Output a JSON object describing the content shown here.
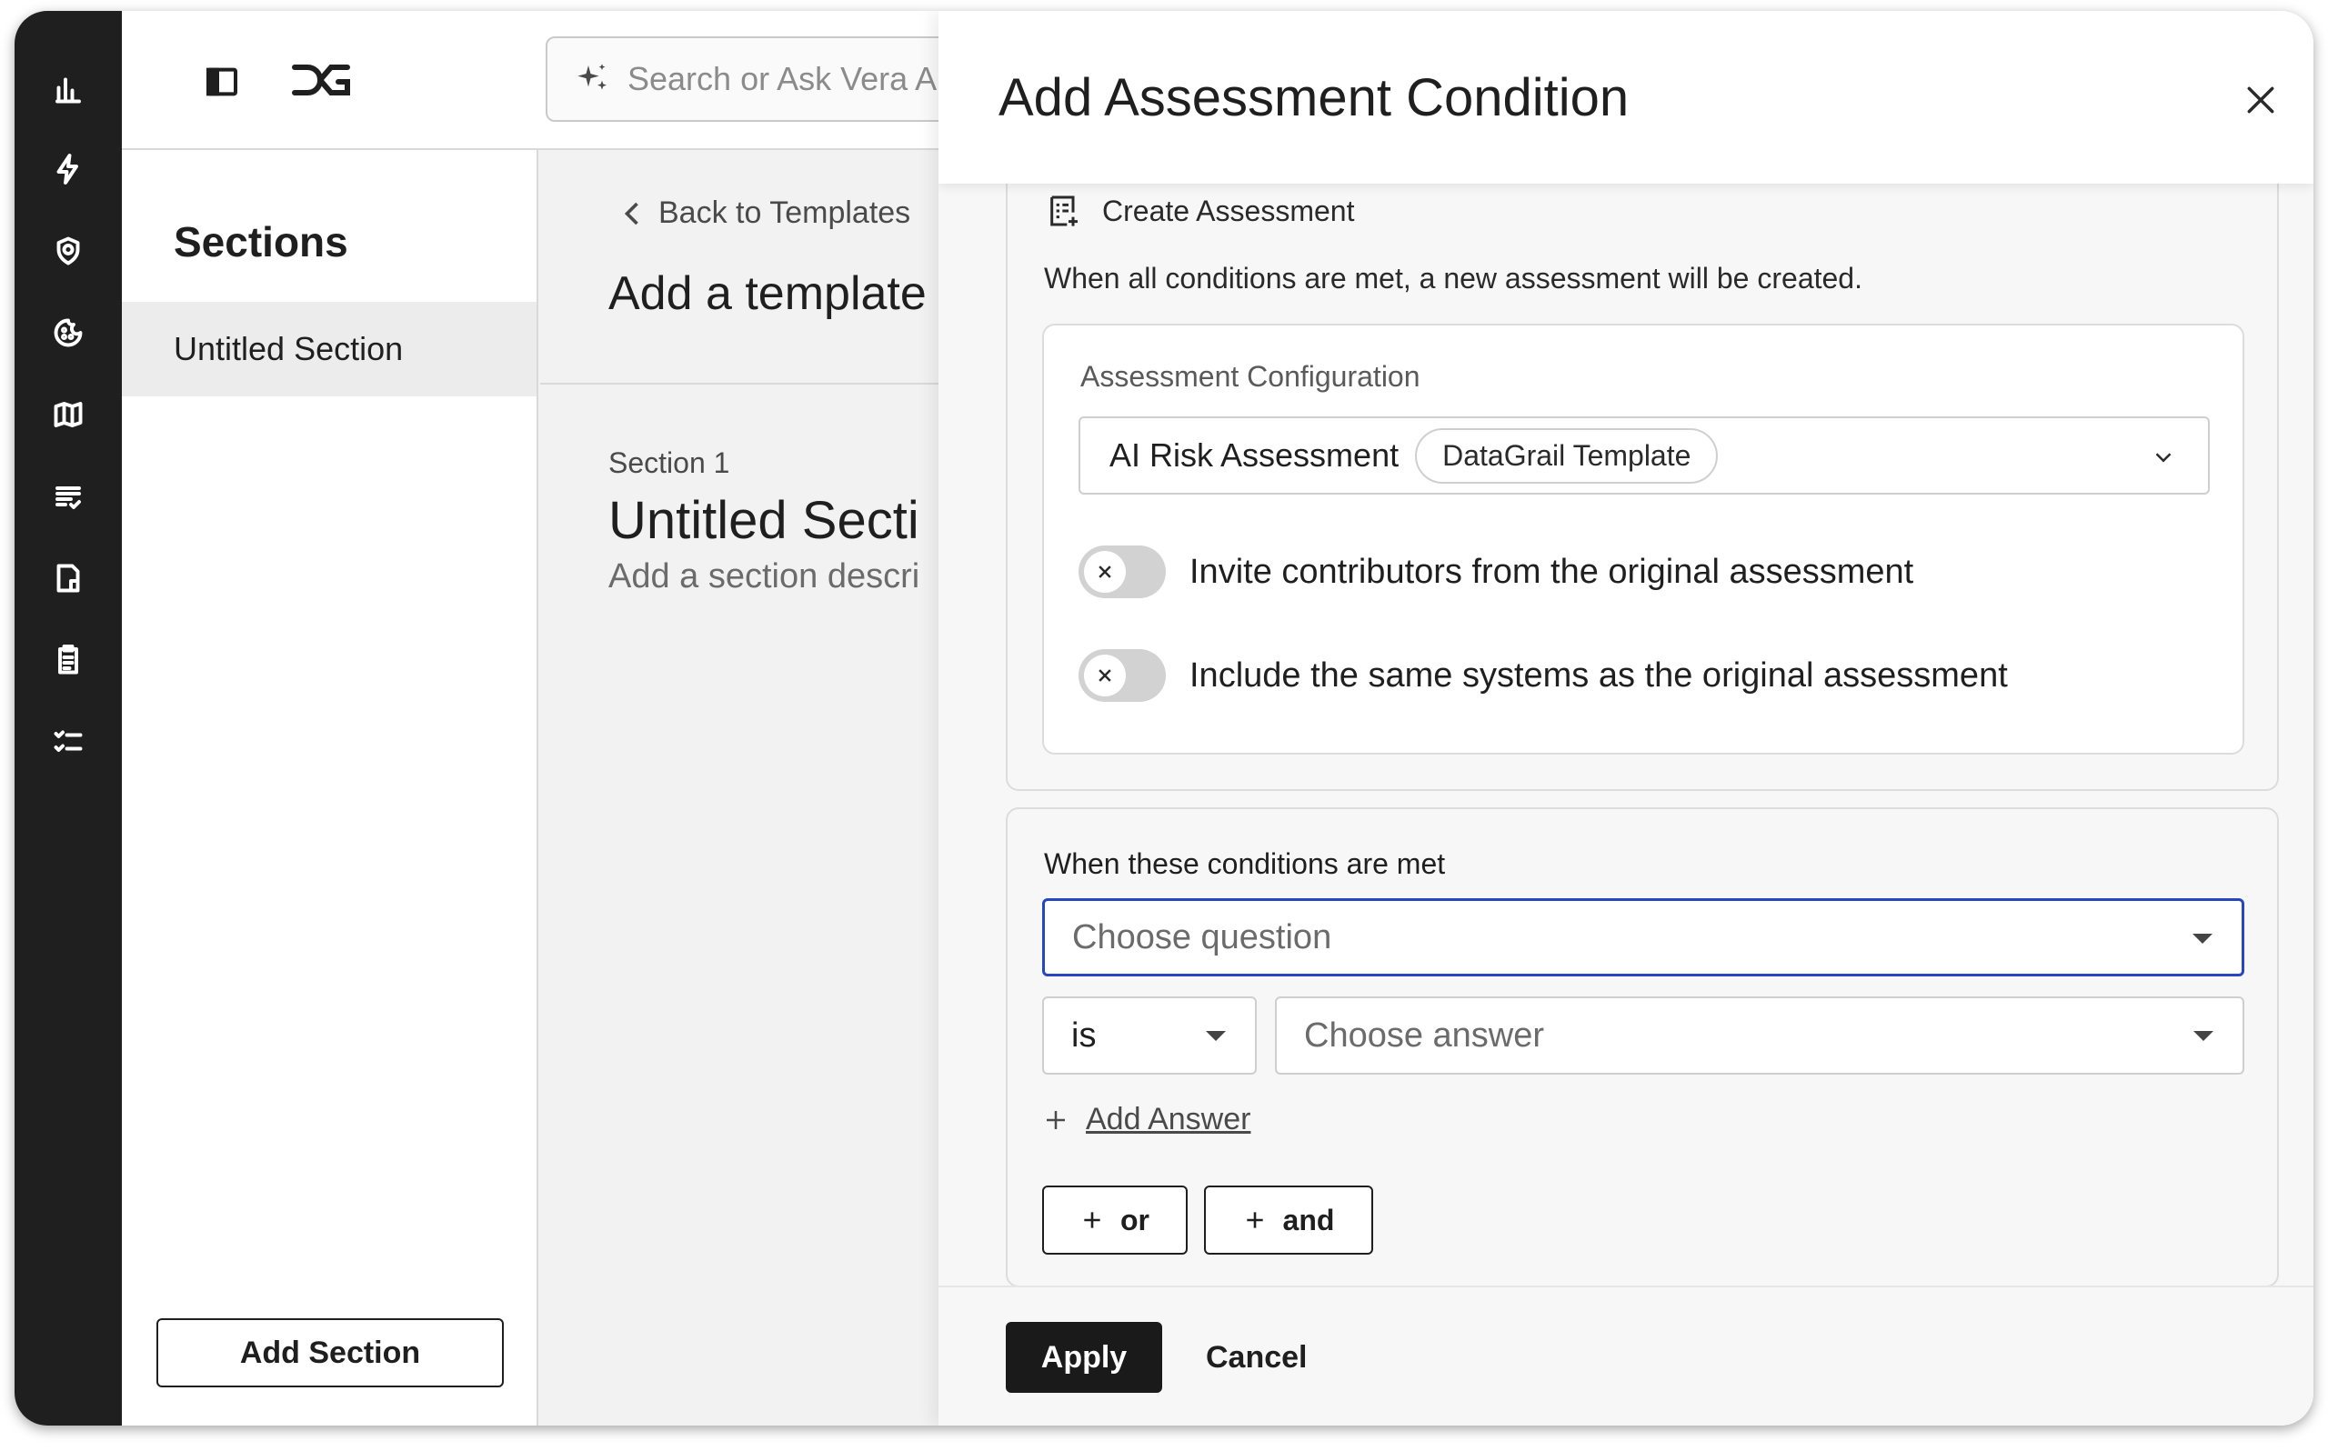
{
  "rail": {
    "icons": [
      "analytics-icon",
      "lightning-icon",
      "shield-check-icon",
      "cookie-icon",
      "map-icon",
      "list-check-icon",
      "document-icon",
      "clipboard-icon",
      "checklist-icon"
    ]
  },
  "header": {
    "search_placeholder": "Search or Ask Vera AI Anyt"
  },
  "sections": {
    "title": "Sections",
    "items": [
      {
        "label": "Untitled Section"
      }
    ],
    "add_button": "Add Section"
  },
  "main": {
    "back_label": "Back to Templates",
    "title": "Add a template",
    "section_number": "Section 1",
    "section_title": "Untitled Secti",
    "section_description": "Add a section descri"
  },
  "drawer": {
    "title": "Add Assessment Condition",
    "action": {
      "label": "Create Assessment",
      "description": "When all conditions are met, a new assessment will be created."
    },
    "config": {
      "label": "Assessment Configuration",
      "selected_value": "AI Risk Assessment",
      "selected_badge": "DataGrail Template",
      "toggles": [
        {
          "label": "Invite contributors from the original assessment",
          "on": false
        },
        {
          "label": "Include the same systems as the original assessment",
          "on": false
        }
      ]
    },
    "conditions": {
      "label": "When these conditions are met",
      "question_placeholder": "Choose question",
      "operator": "is",
      "answer_placeholder": "Choose answer",
      "add_answer": "Add Answer",
      "or_button": "or",
      "and_button": "and"
    },
    "footer": {
      "apply": "Apply",
      "cancel": "Cancel"
    }
  },
  "colors": {
    "rail": "#1f1f1f",
    "focus_border": "#2845c2",
    "primary_button": "#1a1a1a"
  }
}
